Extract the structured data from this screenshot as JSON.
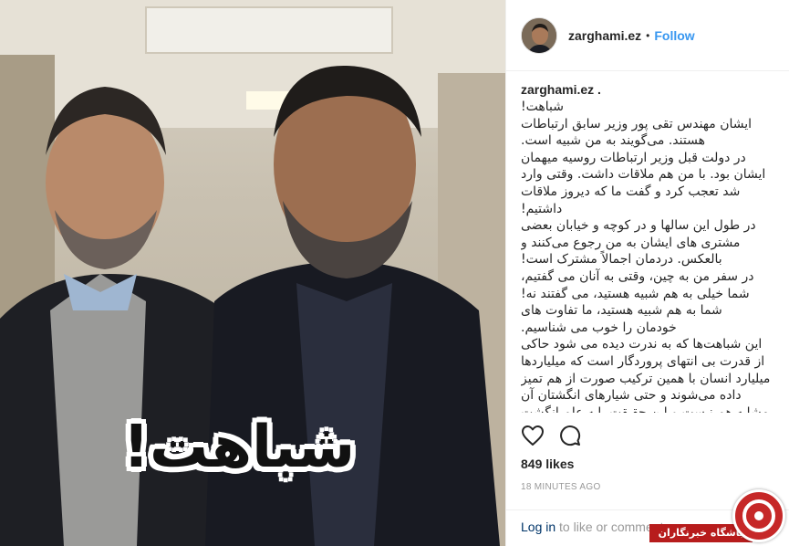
{
  "post": {
    "username": "zarghami.ez",
    "separator": "•",
    "follow_label": "Follow",
    "image_caption": "شباهت!"
  },
  "caption": {
    "username": "zarghami.ez .",
    "lines": [
      "شباهت!",
      "ایشان مهندس تقی پور وزیر سابق ارتباطات",
      "هستند. می‌گویند به من شبیه است.",
      "در دولت قبل وزیر ارتباطات روسیه میهمان",
      "ایشان بود. با من هم ملاقات داشت. وقتی وارد",
      "شد تعجب کرد و گفت ما که دیروز ملاقات",
      "داشتیم!",
      "در طول این سالها و در کوچه و خیابان بعضی",
      "مشتری های ایشان به من رجوع می‌کنند و",
      "بالعکس. دردمان اجمالاً مشترک است!",
      "در سفر من به چین، وقتی به آنان می گفتیم،",
      "شما خیلی به هم شبیه هستید، می گفتند نه!",
      "شما به هم شبیه هستید، ما تفاوت های",
      "خودمان را خوب می شناسیم.",
      "این شباهت‌ها که به ندرت دیده می شود حاکی",
      "از قدرت بی انتهای پروردگار است که میلیاردها",
      "میلیارد انسان با همین ترکیب صورت از هم تمیز",
      "داده می‌شوند و حتی شیارهای انگشتان آن",
      "مشابه هم نیست و این حقیقت پایه علم انگشت"
    ]
  },
  "actions": {
    "like_icon": "heart-icon",
    "comment_icon": "comment-icon"
  },
  "likes": "849 likes",
  "timestamp": "18 MINUTES AGO",
  "footer": {
    "login_label": "Log in",
    "rest": "to like or comment."
  },
  "watermark": {
    "text": "باشگاه خبرنگاران"
  },
  "colors": {
    "link": "#3897f0",
    "text": "#262626",
    "muted": "#999999",
    "watermark": "#c62828"
  }
}
